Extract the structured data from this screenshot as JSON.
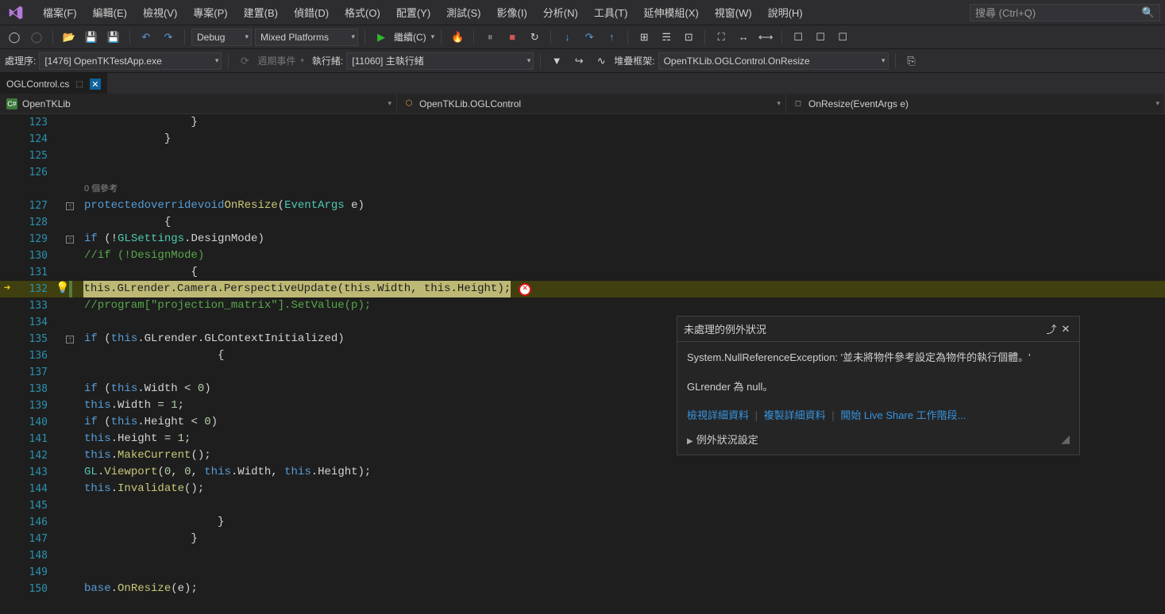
{
  "menu": {
    "items": [
      "檔案(F)",
      "編輯(E)",
      "檢視(V)",
      "專案(P)",
      "建置(B)",
      "偵錯(D)",
      "格式(O)",
      "配置(Y)",
      "測試(S)",
      "影像(I)",
      "分析(N)",
      "工具(T)",
      "延伸模組(X)",
      "視窗(W)",
      "說明(H)"
    ],
    "search_placeholder": "搜尋 (Ctrl+Q)"
  },
  "toolbar": {
    "config": "Debug",
    "platform": "Mixed Platforms",
    "continue_label": "繼續(C)",
    "process_label": "處理序:",
    "process_value": "[1476] OpenTKTestApp.exe",
    "lifecycle_label": "週期事件",
    "thread_label": "執行緒:",
    "thread_value": "[11060] 主執行緒",
    "stackframe_label": "堆疊框架:",
    "stackframe_value": "OpenTKLib.OGLControl.OnResize"
  },
  "tab": {
    "name": "OGLControl.cs"
  },
  "nav": {
    "project": "OpenTKLib",
    "class": "OpenTKLib.OGLControl",
    "member": "OnResize(EventArgs e)"
  },
  "code": {
    "codelens": "0 個參考",
    "line_nums": [
      "123",
      "124",
      "125",
      "126",
      "127",
      "128",
      "129",
      "130",
      "131",
      "132",
      "133",
      "134",
      "135",
      "136",
      "137",
      "138",
      "139",
      "140",
      "141",
      "142",
      "143",
      "144",
      "145",
      "146",
      "147",
      "148",
      "149",
      "150"
    ],
    "highlight_text": "this.GLrender.Camera.PerspectiveUpdate(this.Width, this.Height);"
  },
  "exception": {
    "title": "未處理的例外狀況",
    "message": "System.NullReferenceException: '並未將物件參考設定為物件的執行個體。'",
    "detail": "GLrender 為 null。",
    "links": {
      "view": "檢視詳細資料",
      "copy": "複製詳細資料",
      "liveshare": "開始 Live Share 工作階段..."
    },
    "settings": "例外狀況設定"
  }
}
